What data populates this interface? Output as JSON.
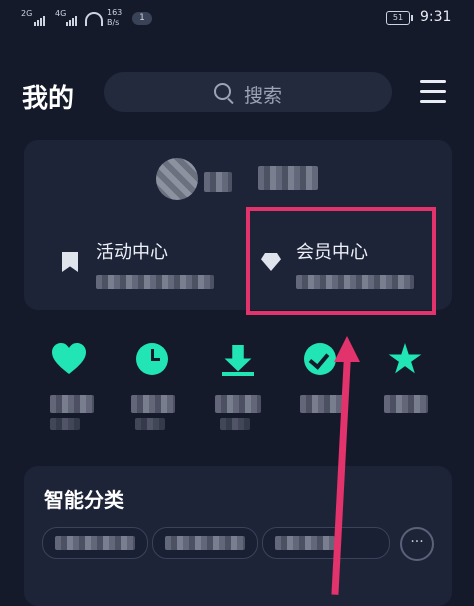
{
  "status_bar": {
    "network1": "2G",
    "network2": "4G",
    "speed_value": "163",
    "speed_unit": "B/s",
    "notification_count": "1",
    "battery_level": "51",
    "time": "9:31"
  },
  "header": {
    "title": "我的",
    "search_placeholder": "搜索",
    "search_icon": "search-icon",
    "menu_icon": "menu-icon"
  },
  "profile_card": {
    "items": [
      {
        "label": "活动中心",
        "icon": "bookmark-icon"
      },
      {
        "label": "会员中心",
        "icon": "diamond-icon"
      }
    ]
  },
  "quick_actions": [
    {
      "icon": "heart-icon"
    },
    {
      "icon": "clock-icon"
    },
    {
      "icon": "download-icon"
    },
    {
      "icon": "check-circle-icon"
    },
    {
      "icon": "star-icon"
    }
  ],
  "smart_category": {
    "title": "智能分类",
    "more_label": "···"
  },
  "colors": {
    "background": "#151a2b",
    "card": "#1e2438",
    "accent": "#21e5b5",
    "annotation": "#e2336c"
  }
}
